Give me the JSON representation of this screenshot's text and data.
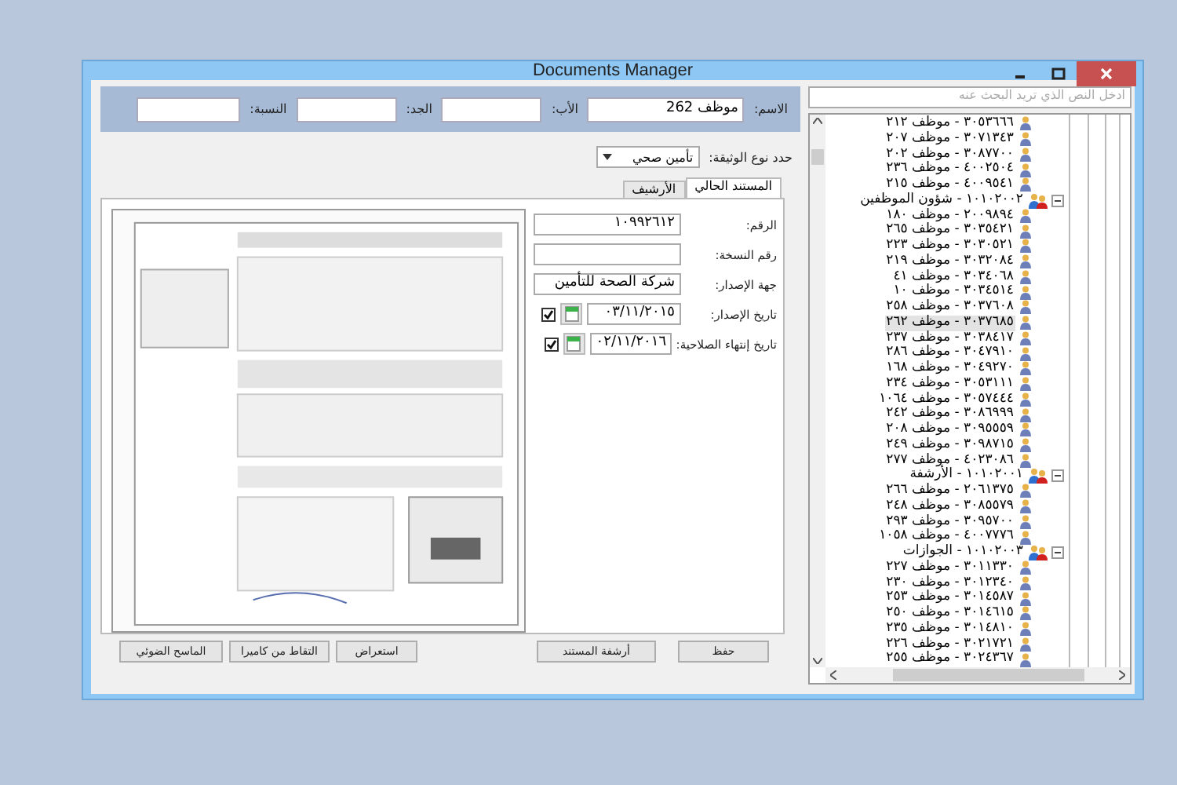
{
  "window": {
    "title": "Documents Manager"
  },
  "header_fields": [
    {
      "label": "الاسم:",
      "value": "موظف 262"
    },
    {
      "label": "الأب:"
    },
    {
      "label": "الجد:"
    },
    {
      "label": "النسبة:"
    }
  ],
  "document_type": {
    "label": "حدد نوع الوثيقة:",
    "value": "تأمين صحي"
  },
  "tabs": [
    {
      "label": "المستند الحالي",
      "selected": true
    },
    {
      "label": "الأرشيف",
      "selected": false
    }
  ],
  "form_fields": [
    {
      "kind": "text",
      "label": "الرقم:",
      "value": "١٠٩٩٢٦١٢"
    },
    {
      "kind": "text",
      "label": "رقم النسخة:"
    },
    {
      "kind": "text",
      "label": "جهة الإصدار:",
      "value": "شركة الصحة للتأمين"
    },
    {
      "kind": "date",
      "label": "تاريخ الإصدار:",
      "value": "٠٣/١١/٢٠١٥",
      "checked": true
    },
    {
      "kind": "date",
      "label": "تاريخ إنتهاء الصلاحية:",
      "value": "٠٢/١١/٢٠١٦",
      "checked": true
    }
  ],
  "buttons_left": [
    "استعراض",
    "التقاط من كاميرا",
    "الماسح الضوئي"
  ],
  "buttons_right": [
    "حفظ",
    "أرشفة المستند"
  ],
  "search": {
    "placeholder": "ادخل النص الذي تريد البحث عنه"
  },
  "tree": [
    {
      "kind": "employee",
      "label": "٣٠٥٣٦٦٦ - موظف ٢١٢",
      "selected": false
    },
    {
      "kind": "employee",
      "label": "٣٠٧١٣٤٣ - موظف ٢٠٧",
      "selected": false
    },
    {
      "kind": "employee",
      "label": "٣٠٨٧٧٠٠ - موظف ٢٠٢",
      "selected": false
    },
    {
      "kind": "employee",
      "label": "٤٠٠٢٥٠٤ - موظف ٢٣٦",
      "selected": false
    },
    {
      "kind": "employee",
      "label": "٤٠٠٩٥٤١ - موظف ٢١٥",
      "selected": false
    },
    {
      "kind": "department",
      "label": "١٠١٠٢٠٠٢ - شؤون الموظفين",
      "expanded": true,
      "selected": false,
      "children": [
        {
          "kind": "employee",
          "label": "٢٠٠٩٨٩٤ - موظف ١٨٠",
          "selected": false
        },
        {
          "kind": "employee",
          "label": "٣٠٣٥٤٢١ - موظف ٢٦٥",
          "selected": false
        },
        {
          "kind": "employee",
          "label": "٣٠٣٠٥٢١ - موظف ٢٢٣",
          "selected": false
        },
        {
          "kind": "employee",
          "label": "٣٠٣٢٠٨٤ - موظف ٢١٩",
          "selected": false
        },
        {
          "kind": "employee",
          "label": "٣٠٣٤٠٦٨ - موظف ٤١",
          "selected": false
        },
        {
          "kind": "employee",
          "label": "٣٠٣٤٥١٤ - موظف ١٠",
          "selected": false
        },
        {
          "kind": "employee",
          "label": "٣٠٣٧٦٠٨ - موظف ٢٥٨",
          "selected": false
        },
        {
          "kind": "employee",
          "label": "٣٠٣٧٦٨٥ - موظف ٢٦٢",
          "selected": true
        },
        {
          "kind": "employee",
          "label": "٣٠٣٨٤١٧ - موظف ٢٣٧",
          "selected": false
        },
        {
          "kind": "employee",
          "label": "٣٠٤٧٩١٠ - موظف ٢٨٦",
          "selected": false
        },
        {
          "kind": "employee",
          "label": "٣٠٤٩٢٧٠ - موظف ١٦٨",
          "selected": false
        },
        {
          "kind": "employee",
          "label": "٣٠٥٣١١١ - موظف ٢٣٤",
          "selected": false
        },
        {
          "kind": "employee",
          "label": "٣٠٥٧٤٤٤ - موظف ١٠٦٤",
          "selected": false
        },
        {
          "kind": "employee",
          "label": "٣٠٨٦٩٩٩ - موظف ٢٤٢",
          "selected": false
        },
        {
          "kind": "employee",
          "label": "٣٠٩٥٥٥٩ - موظف ٢٠٨",
          "selected": false
        },
        {
          "kind": "employee",
          "label": "٣٠٩٨٧١٥ - موظف ٢٤٩",
          "selected": false
        },
        {
          "kind": "employee",
          "label": "٤٠٢٣٠٨٦ - موظف ٢٧٧",
          "selected": false
        }
      ]
    },
    {
      "kind": "department",
      "label": "١٠١٠٢٠٠١ - الأرشفة",
      "expanded": true,
      "selected": false,
      "children": [
        {
          "kind": "employee",
          "label": "٢٠٦١٣٧٥ - موظف ٢٦٦",
          "selected": false
        },
        {
          "kind": "employee",
          "label": "٣٠٨٥٥٧٩ - موظف ٢٤٨",
          "selected": false
        },
        {
          "kind": "employee",
          "label": "٣٠٩٥٧٠٠ - موظف ٢٩٣",
          "selected": false
        },
        {
          "kind": "employee",
          "label": "٤٠٠٧٧٧٦ - موظف ١٠٥٨",
          "selected": false
        }
      ]
    },
    {
      "kind": "department",
      "label": "١٠١٠٢٠٠٣ - الجوازات",
      "expanded": true,
      "selected": false,
      "children": [
        {
          "kind": "employee",
          "label": "٣٠١١٣٣٠ - موظف ٢٢٧",
          "selected": false
        },
        {
          "kind": "employee",
          "label": "٣٠١٢٣٤٠ - موظف ٢٣٠",
          "selected": false
        },
        {
          "kind": "employee",
          "label": "٣٠١٤٥٨٧ - موظف ٢٥٣",
          "selected": false
        },
        {
          "kind": "employee",
          "label": "٣٠١٤٦١٥ - موظف ٢٥٠",
          "selected": false
        },
        {
          "kind": "employee",
          "label": "٣٠١٤٨١٠ - موظف ٢٣٥",
          "selected": false
        },
        {
          "kind": "employee",
          "label": "٣٠٢١٧٢١ - موظف ٢٢٦",
          "selected": false
        },
        {
          "kind": "employee",
          "label": "٣٠٢٤٣٦٧ - موظف ٢٥٥",
          "selected": false
        }
      ]
    }
  ]
}
